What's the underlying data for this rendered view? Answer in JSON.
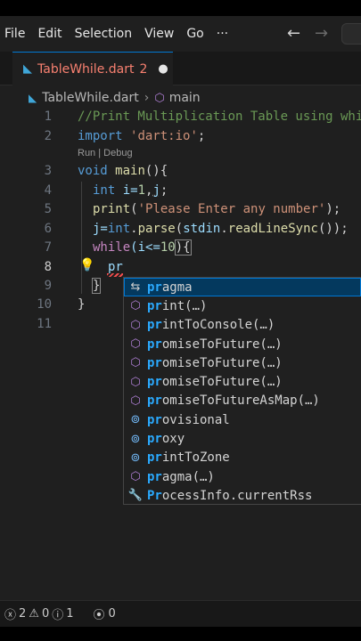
{
  "menubar": {
    "items": [
      "File",
      "Edit",
      "Selection",
      "View",
      "Go",
      "···"
    ],
    "back_glyph": "←",
    "forward_glyph": "→"
  },
  "tab": {
    "label": "TableWhile.dart",
    "badge": "2",
    "dirty_glyph": "●"
  },
  "breadcrumb": {
    "file": "TableWhile.dart",
    "separator": "›",
    "symbol": "main"
  },
  "editor": {
    "line_numbers": [
      "1",
      "2",
      "3",
      "4",
      "5",
      "6",
      "7",
      "8",
      "9",
      "10",
      "11"
    ],
    "codelens": "Run | Debug",
    "lines": {
      "l1": "//Print Multiplication Table using while",
      "l2_kw": "import",
      "l2_str": "'dart:io'",
      "l2_end": ";",
      "l3_kw": "void",
      "l3_fn": "main",
      "l3_end": "(){",
      "l4_kw": "int",
      "l4_rest": " i=",
      "l4_num": "1",
      "l4_rest2": ",",
      "l4_var": "j",
      "l4_end": ";",
      "l5_fn": "print",
      "l5_open": "(",
      "l5_str": "'Please Enter any number'",
      "l5_end": ");",
      "l6_a": "j=",
      "l6_kw": "int",
      "l6_b": ".",
      "l6_fn": "parse",
      "l6_c": "(",
      "l6_var": "stdin",
      "l6_d": ".",
      "l6_fn2": "readLineSync",
      "l6_e": "());",
      "l7_ctl": "while",
      "l7_a": "(i<=",
      "l7_num": "10",
      "l7_b": "){",
      "l8_text": "pr",
      "l9_text": "}",
      "l10_text": "}"
    }
  },
  "suggestions": [
    {
      "icon": "snippet-icon",
      "match": "pr",
      "rest": "agma",
      "selected": true
    },
    {
      "icon": "method-icon",
      "match": "pr",
      "rest": "int(…)",
      "selected": false
    },
    {
      "icon": "method-icon",
      "match": "pr",
      "rest": "intToConsole(…)",
      "selected": false
    },
    {
      "icon": "method-icon",
      "match": "pr",
      "rest": "omiseToFuture(…)",
      "selected": false
    },
    {
      "icon": "method-icon",
      "match": "pr",
      "rest": "omiseToFuture(…)",
      "selected": false
    },
    {
      "icon": "method-icon",
      "match": "pr",
      "rest": "omiseToFuture(…)",
      "selected": false
    },
    {
      "icon": "method-icon",
      "match": "pr",
      "rest": "omiseToFutureAsMap(…)",
      "selected": false
    },
    {
      "icon": "field-icon",
      "match": "pr",
      "rest": "ovisional",
      "selected": false
    },
    {
      "icon": "field-icon",
      "match": "pr",
      "rest": "oxy",
      "selected": false
    },
    {
      "icon": "field-icon",
      "match": "pr",
      "rest": "intToZone",
      "selected": false
    },
    {
      "icon": "method-icon",
      "match": "pr",
      "rest": "agma(…)",
      "selected": false
    },
    {
      "icon": "wrench-icon",
      "match": "Pr",
      "rest": "ocessInfo.currentRss",
      "selected": false
    }
  ],
  "statusbar": {
    "errors": "2",
    "warnings": "0",
    "infos": "1",
    "ports": "0"
  },
  "colors": {
    "accent": "#0078d4",
    "match_highlight": "#2aaaff",
    "tab_error": "#f88070"
  }
}
